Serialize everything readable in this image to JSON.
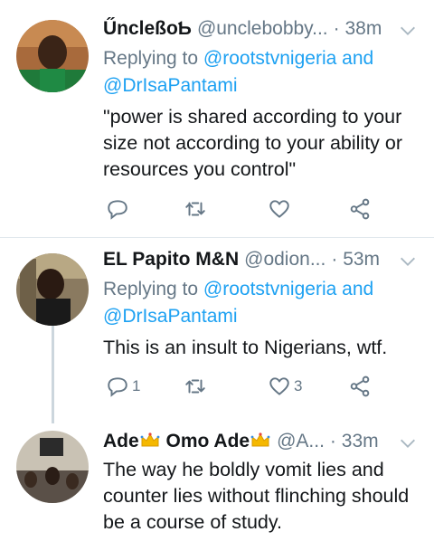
{
  "tweets": [
    {
      "display_name": "ŰncleßoƄ",
      "handle": "@unclebobby...",
      "separator": "·",
      "time": "38m",
      "replying_prefix": "Replying to",
      "mentions": [
        "@rootstvnigeria",
        "@DrIsaPantami"
      ],
      "and_word": "and",
      "text": "\"power is shared according to your size not according to your ability or resources you control\"",
      "reply_count": "",
      "retweet_count": "",
      "like_count": ""
    },
    {
      "display_name": "EL Papito M&N",
      "handle": "@odion...",
      "separator": "·",
      "time": "53m",
      "replying_prefix": "Replying to",
      "mentions": [
        "@rootstvnigeria",
        "@DrIsaPantami"
      ],
      "and_word": "and",
      "text": "This is an insult to Nigerians, wtf.",
      "reply_count": "1",
      "retweet_count": "",
      "like_count": "3"
    },
    {
      "display_name_part1": "Ade",
      "display_name_part2": "Omo Ade",
      "handle": "@A...",
      "separator": "·",
      "time": "33m",
      "text": "The way he boldly vomit lies and counter lies without flinching should be a course of study."
    }
  ],
  "icons": {
    "reply": "reply-icon",
    "retweet": "retweet-icon",
    "like": "heart-icon",
    "share": "share-icon",
    "caret": "chevron-down-icon",
    "crown": "crown-emoji"
  },
  "colors": {
    "link": "#1da1f2",
    "muted": "#657786",
    "text": "#14171a",
    "divider": "#e1e8ed",
    "thread_line": "#ccd6dd"
  }
}
